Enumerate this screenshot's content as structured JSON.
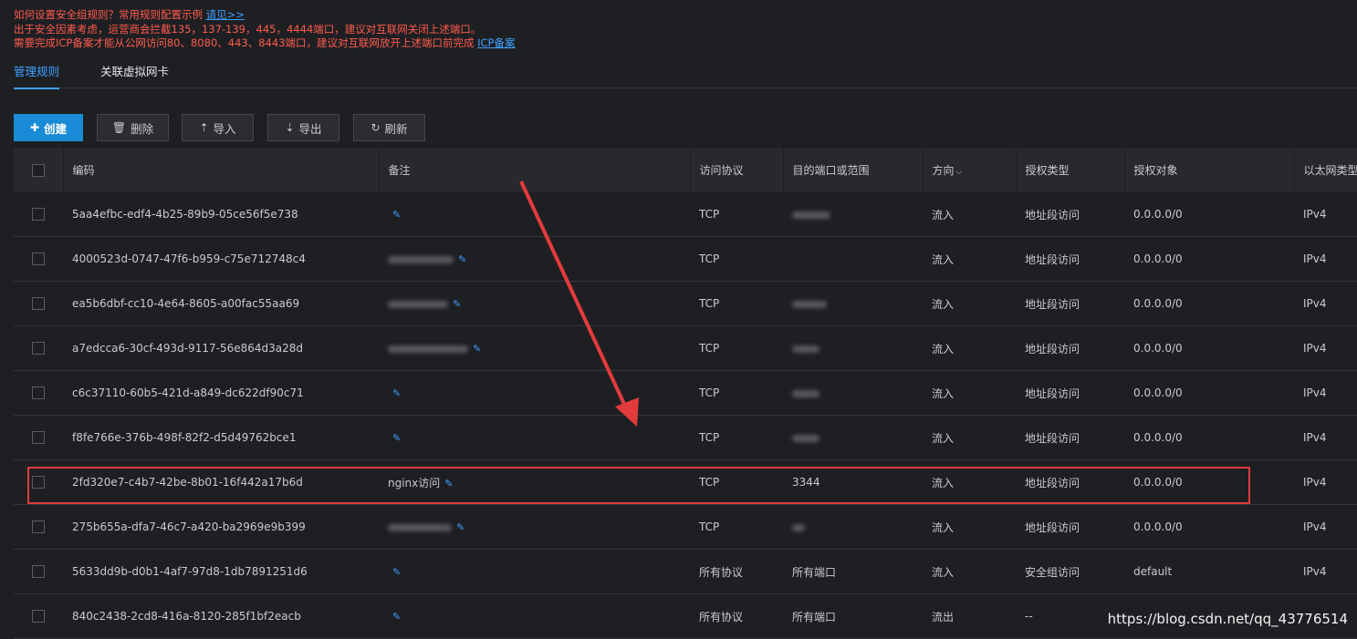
{
  "notice": {
    "line1": "如何设置安全组规则？常用规则配置示例 ",
    "link1": "请见>>",
    "line2": "出于安全因素考虑，运营商会拦截135，137-139，445，4444端口，建议对互联网关闭上述端口。",
    "line3": "需要完成ICP备案才能从公网访问80、8080、443、8443端口，建议对互联网放开上述端口前完成 ",
    "link3": "ICP备案"
  },
  "tabs": [
    "管理规则",
    "关联虚拟网卡"
  ],
  "toolbar": {
    "create": "创建",
    "delete": "删除",
    "import": "导入",
    "export": "导出",
    "refresh": "刷新"
  },
  "table": {
    "headers": [
      "编码",
      "备注",
      "访问协议",
      "目的端口或范围",
      "方向",
      "授权类型",
      "授权对象",
      "以太网类型"
    ],
    "rows": [
      {
        "id": "5aa4efbc-edf4-4b25-89b9-05ce56f5e738",
        "note": "",
        "protocol": "TCP",
        "port": "",
        "direction": "流入",
        "auth_type": "地址段访问",
        "auth_obj": "0.0.0.0/0",
        "eth": "IPv4"
      },
      {
        "id": "4000523d-0747-47f6-b959-c75e712748c4",
        "note": "",
        "protocol": "TCP",
        "port": "",
        "direction": "流入",
        "auth_type": "地址段访问",
        "auth_obj": "0.0.0.0/0",
        "eth": "IPv4"
      },
      {
        "id": "ea5b6dbf-cc10-4e64-8605-a00fac55aa69",
        "note": "",
        "protocol": "TCP",
        "port": "",
        "direction": "流入",
        "auth_type": "地址段访问",
        "auth_obj": "0.0.0.0/0",
        "eth": "IPv4"
      },
      {
        "id": "a7edcca6-30cf-493d-9117-56e864d3a28d",
        "note": "",
        "protocol": "TCP",
        "port": "",
        "direction": "流入",
        "auth_type": "地址段访问",
        "auth_obj": "0.0.0.0/0",
        "eth": "IPv4"
      },
      {
        "id": "c6c37110-60b5-421d-a849-dc622df90c71",
        "note": "",
        "protocol": "TCP",
        "port": "",
        "direction": "流入",
        "auth_type": "地址段访问",
        "auth_obj": "0.0.0.0/0",
        "eth": "IPv4"
      },
      {
        "id": "f8fe766e-376b-498f-82f2-d5d49762bce1",
        "note": "",
        "protocol": "TCP",
        "port": "",
        "direction": "流入",
        "auth_type": "地址段访问",
        "auth_obj": "0.0.0.0/0",
        "eth": "IPv4"
      },
      {
        "id": "2fd320e7-c4b7-42be-8b01-16f442a17b6d",
        "note": "nginx访问",
        "protocol": "TCP",
        "port": "3344",
        "direction": "流入",
        "auth_type": "地址段访问",
        "auth_obj": "0.0.0.0/0",
        "eth": "IPv4"
      },
      {
        "id": "275b655a-dfa7-46c7-a420-ba2969e9b399",
        "note": "",
        "protocol": "TCP",
        "port": "",
        "direction": "流入",
        "auth_type": "地址段访问",
        "auth_obj": "0.0.0.0/0",
        "eth": "IPv4"
      },
      {
        "id": "5633dd9b-d0b1-4af7-97d8-1db7891251d6",
        "note": "",
        "protocol": "所有协议",
        "port": "所有端口",
        "direction": "流入",
        "auth_type": "安全组访问",
        "auth_obj": "default",
        "eth": "IPv4"
      },
      {
        "id": "840c2438-2cd8-416a-8120-285f1bf2eacb",
        "note": "",
        "protocol": "所有协议",
        "port": "所有端口",
        "direction": "流出",
        "auth_type": "--",
        "auth_obj": "",
        "eth": ""
      }
    ]
  },
  "watermark": "https://blog.csdn.net/qq_43776514",
  "colors": {
    "accent": "#3fa0ff",
    "warning": "#ff5b4c",
    "highlight": "#e03a3a"
  }
}
